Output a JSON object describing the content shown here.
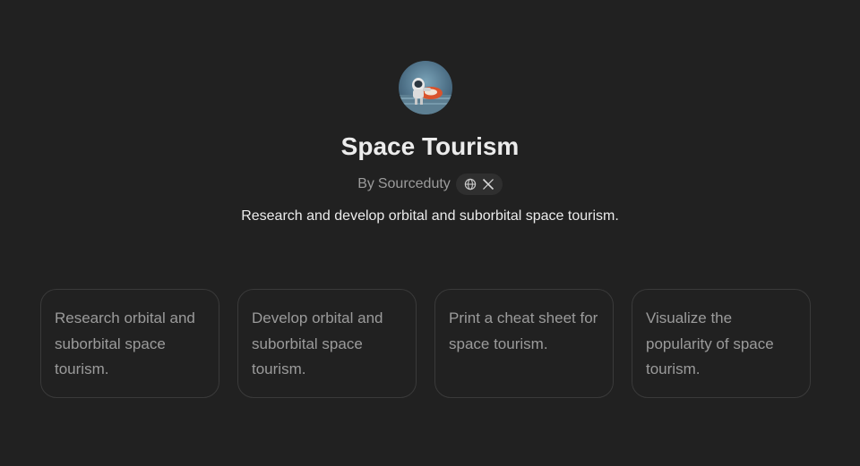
{
  "gpt": {
    "avatar_icon": "astronaut-avatar-image",
    "title": "Space Tourism",
    "byline_prefix": "By",
    "author": "Sourceduty",
    "social_icons": [
      "globe-icon",
      "x-icon"
    ],
    "description": "Research and develop orbital and suborbital space tourism."
  },
  "conversation_starters": [
    {
      "label": "Research orbital and suborbital space tourism."
    },
    {
      "label": "Develop orbital and suborbital space tourism."
    },
    {
      "label": "Print a cheat sheet for space tourism."
    },
    {
      "label": "Visualize the popularity of space tourism."
    }
  ],
  "colors": {
    "background": "#212121",
    "title": "#ececec",
    "muted": "#9b9b9b",
    "card_border": "#3a3a3a",
    "pill": "#2f2f2f"
  }
}
